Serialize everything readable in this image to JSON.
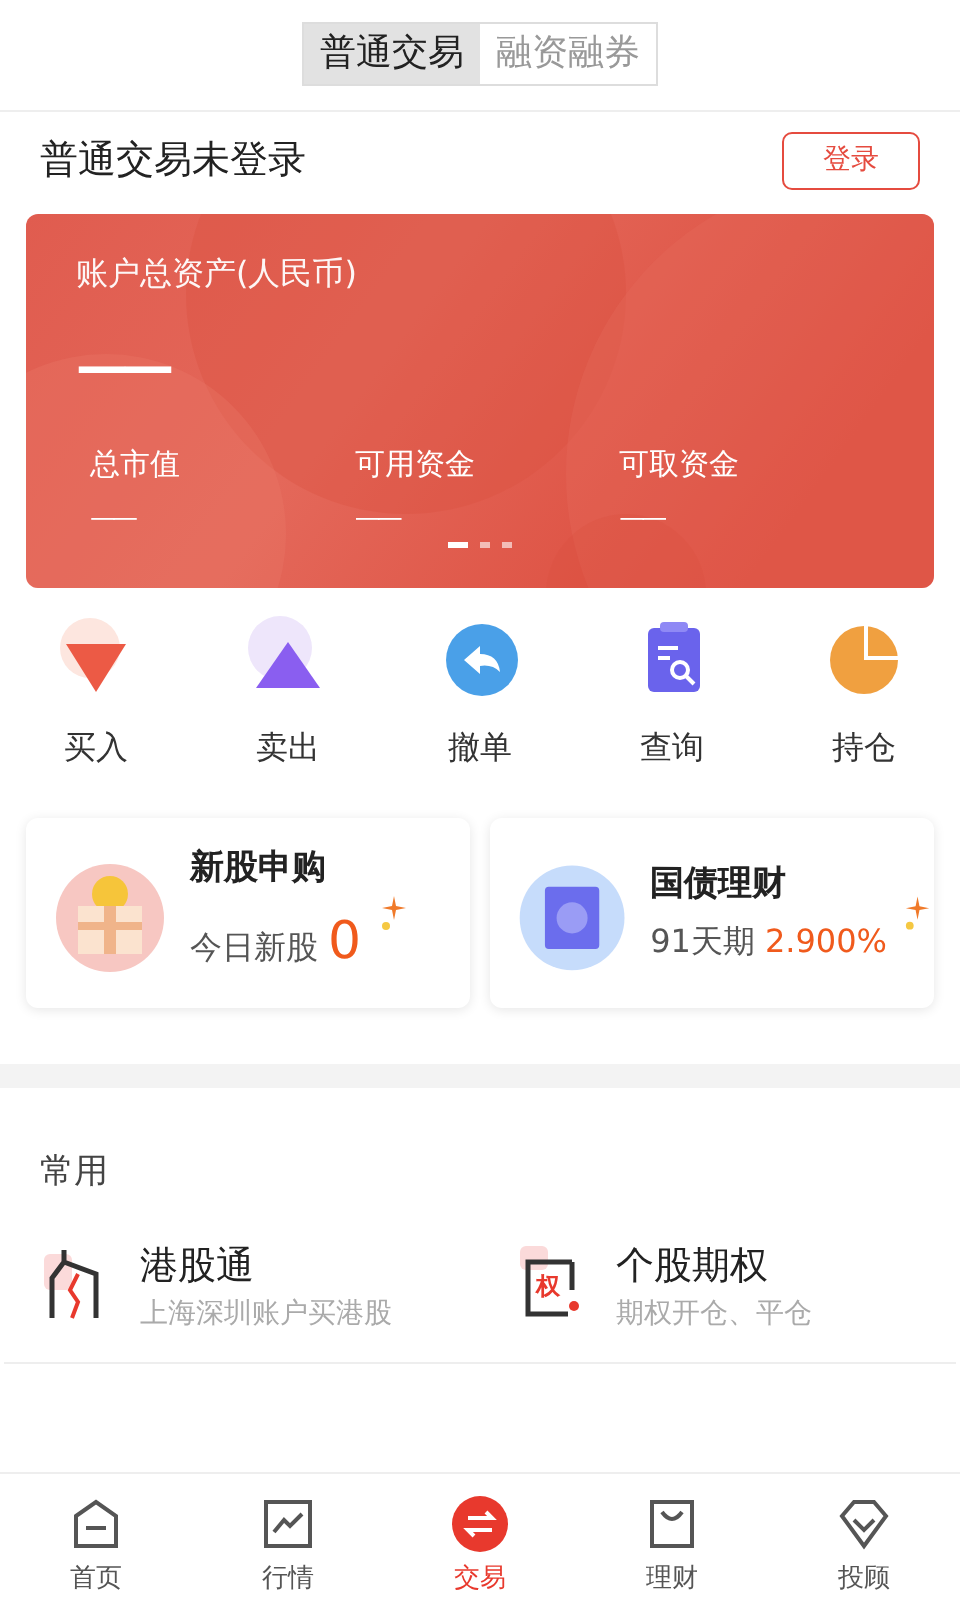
{
  "mode_tabs": [
    {
      "label": "普通交易",
      "selected": true
    },
    {
      "label": "融资融券",
      "selected": false
    }
  ],
  "header": {
    "title": "普通交易未登录",
    "login_button": "登录"
  },
  "asset_card": {
    "title": "账户总资产(人民币)",
    "total": "——",
    "fields": [
      {
        "label": "总市值",
        "value": "——"
      },
      {
        "label": "可用资金",
        "value": "——"
      },
      {
        "label": "可取资金",
        "value": "——"
      }
    ],
    "pages": [
      {
        "selected": true
      },
      {
        "selected": false
      },
      {
        "selected": false
      }
    ]
  },
  "actions": [
    {
      "kind": "buy",
      "label": "买入"
    },
    {
      "kind": "sell",
      "label": "卖出"
    },
    {
      "kind": "cancel",
      "label": "撤单"
    },
    {
      "kind": "query",
      "label": "查询"
    },
    {
      "kind": "position",
      "label": "持仓"
    }
  ],
  "promos": [
    {
      "kind": "ipo",
      "title": "新股申购",
      "caption": "今日新股",
      "value": "0"
    },
    {
      "kind": "bond",
      "title": "国债理财",
      "caption": "91天期",
      "value": "2.900%"
    }
  ],
  "common": {
    "title": "常用",
    "items": [
      {
        "kind": "hk",
        "title": "港股通",
        "subtitle": "上海深圳账户买港股"
      },
      {
        "kind": "option",
        "title": "个股期权",
        "subtitle": "期权开仓、平仓",
        "icon_text": "权"
      }
    ]
  },
  "bottom_nav": [
    {
      "kind": "home",
      "label": "首页",
      "selected": false
    },
    {
      "kind": "market",
      "label": "行情",
      "selected": false
    },
    {
      "kind": "trade",
      "label": "交易",
      "selected": true
    },
    {
      "kind": "finance",
      "label": "理财",
      "selected": false
    },
    {
      "kind": "advisor",
      "label": "投顾",
      "selected": false
    }
  ]
}
